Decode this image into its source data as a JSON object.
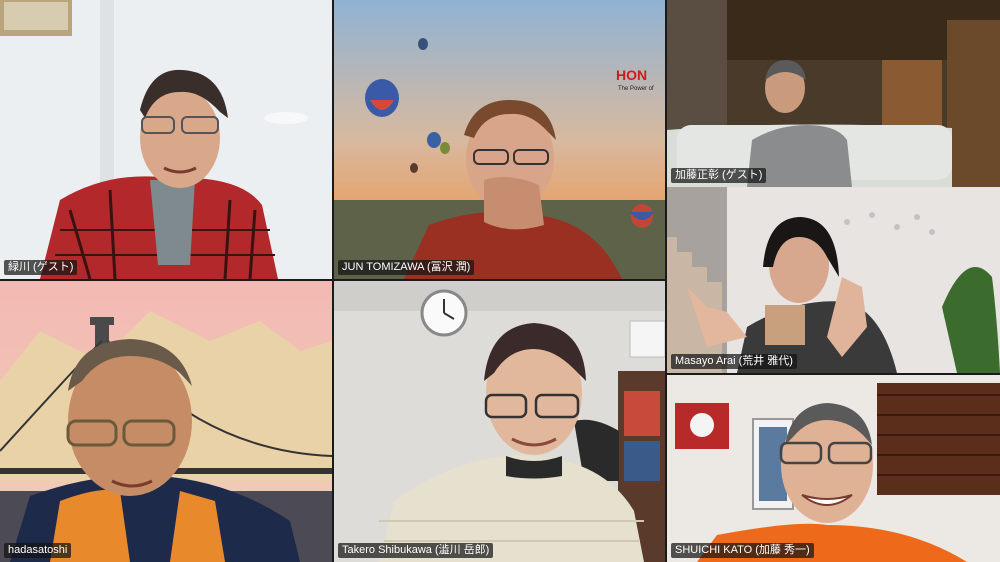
{
  "participants": [
    {
      "name": "緑川 (ゲスト)"
    },
    {
      "name": "JUN TOMIZAWA (冨沢 潤)"
    },
    {
      "name": "加藤正彰 (ゲスト)"
    },
    {
      "name": "Masayo Arai (荒井 雅代)"
    },
    {
      "name": "hadasatoshi"
    },
    {
      "name": "Takero Shibukawa (澁川 岳郎)"
    },
    {
      "name": "SHUICHI KATO (加藤 秀一)"
    }
  ],
  "background_text": {
    "brand_partial": "HON",
    "brand_tagline": "The Power of"
  },
  "colors": {
    "label_bg": "#141414",
    "active_speaker": "#3ad63a"
  }
}
